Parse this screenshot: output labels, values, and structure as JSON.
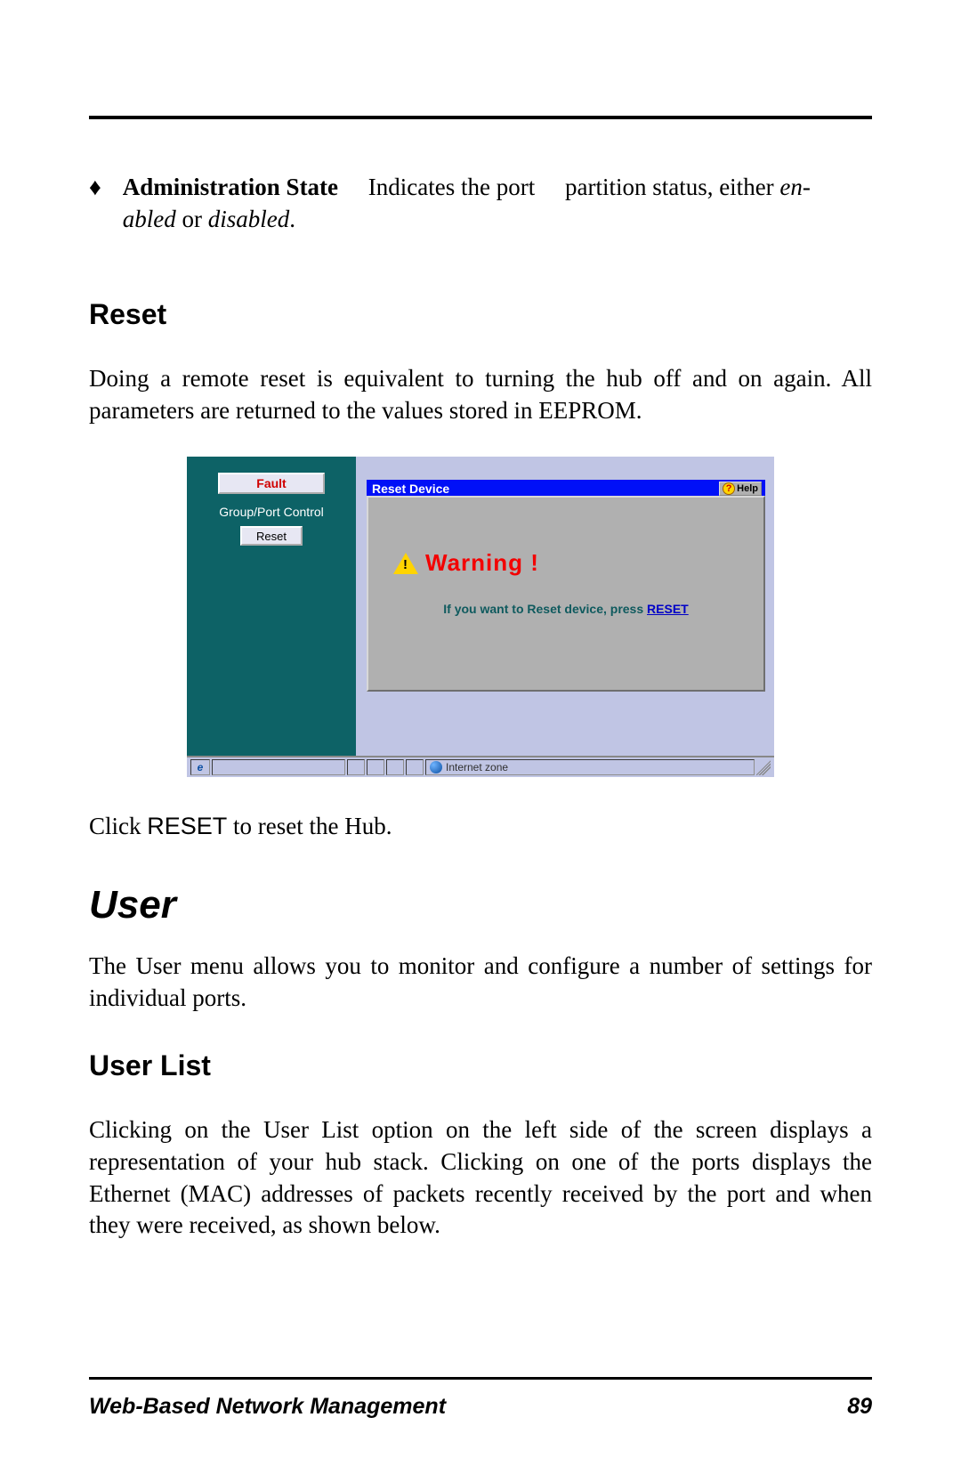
{
  "bullet": {
    "term": "Administration State",
    "mid": "Indicates the port",
    "tail1": "partition status, either ",
    "em1": "en-",
    "em2": "abled",
    "or": " or ",
    "em3": "disabled",
    "dot": "."
  },
  "reset": {
    "heading": "Reset",
    "para": "Doing a remote reset is equivalent to turning the hub off and on again.  All parameters are returned to the values stored in EEPROM."
  },
  "shot": {
    "sidebar": {
      "fault": "Fault",
      "group_port": "Group/Port Control",
      "reset": "Reset"
    },
    "panel": {
      "title": "Reset Device",
      "help": "Help",
      "warning": "Warning !",
      "msg_pre": "If you want to Reset device, press ",
      "msg_link": "RESET"
    },
    "status": {
      "zone": "Internet zone"
    }
  },
  "click_reset": {
    "pre": "Click ",
    "word": "RESET",
    "post": " to reset the Hub."
  },
  "user": {
    "heading": "User",
    "para": "The User menu allows you to monitor and configure a number of settings for individual ports."
  },
  "userlist": {
    "heading": "User List",
    "para": "Clicking on the User List option on the left side of the screen displays a representation of your hub stack. Clicking on one of the ports displays the Ethernet (MAC) addresses of packets recently received by the port and when they were received, as shown below."
  },
  "footer": {
    "title": "Web-Based Network Management",
    "page": "89"
  }
}
